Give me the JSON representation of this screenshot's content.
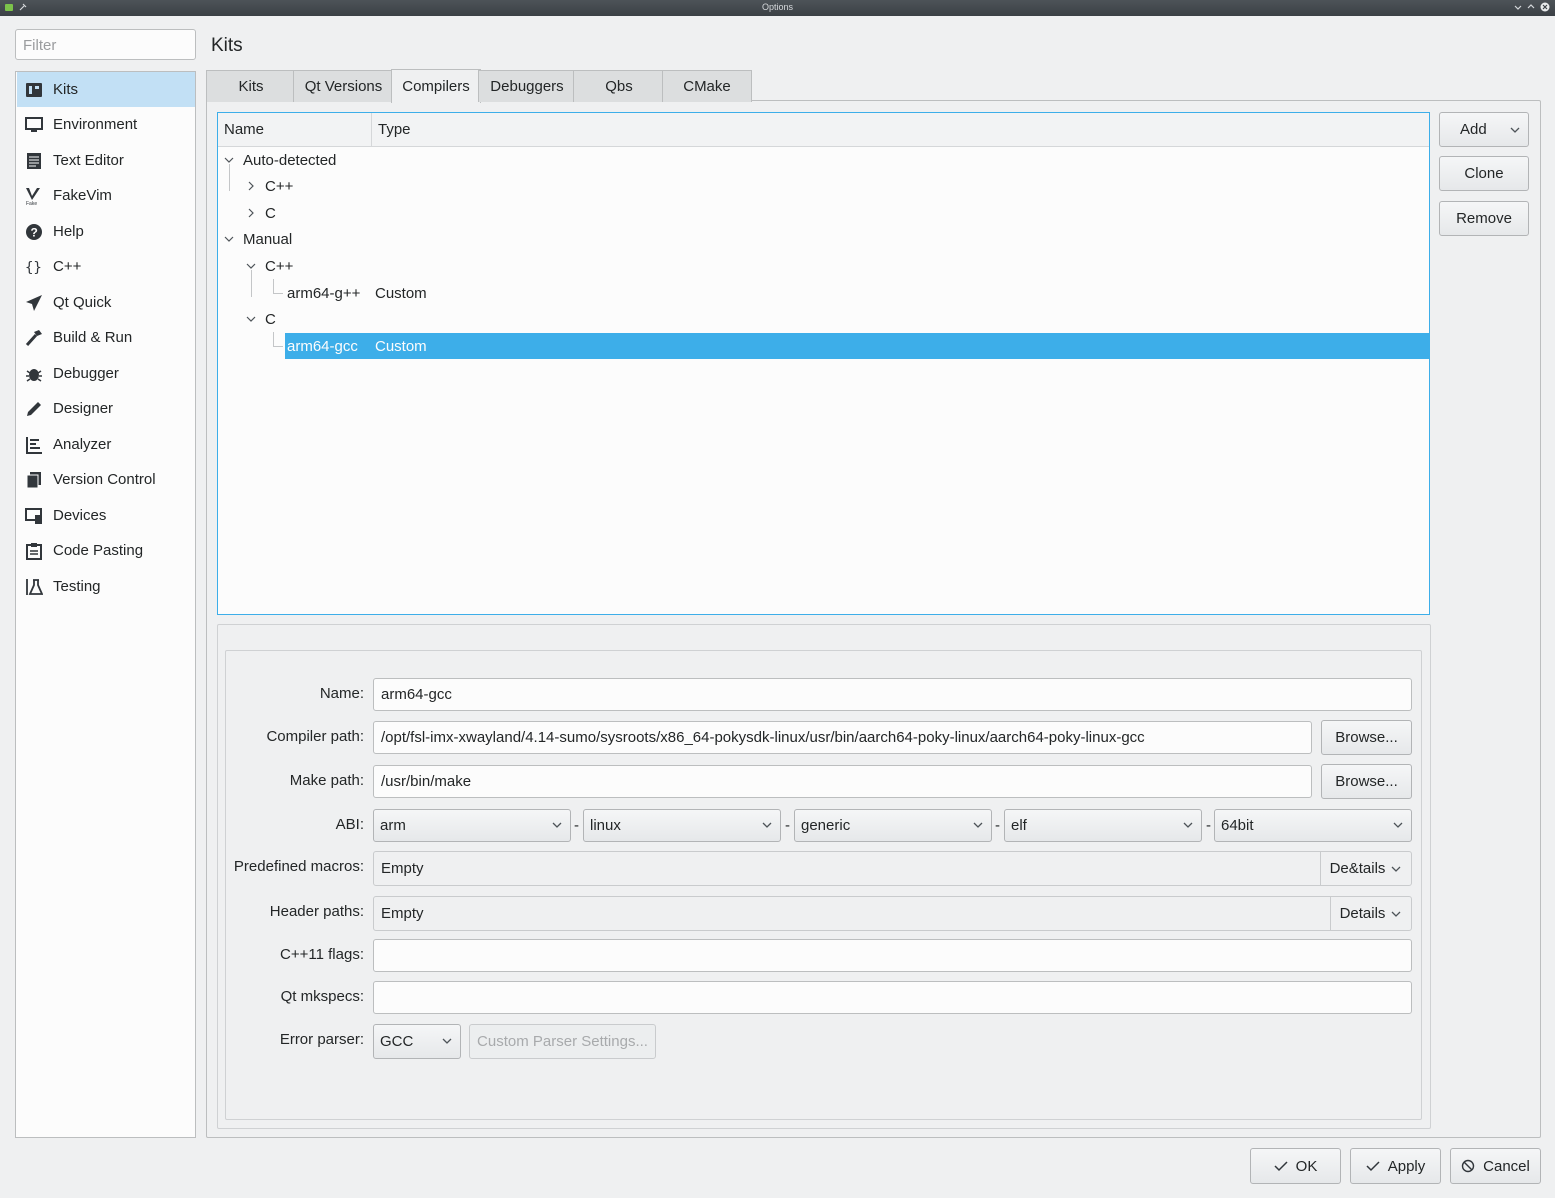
{
  "window": {
    "title": "Options"
  },
  "filter": {
    "placeholder": "Filter"
  },
  "sidebar": {
    "items": [
      {
        "label": "Kits",
        "icon": "kits-icon"
      },
      {
        "label": "Environment",
        "icon": "monitor-icon"
      },
      {
        "label": "Text Editor",
        "icon": "text-editor-icon"
      },
      {
        "label": "FakeVim",
        "icon": "fakevim-icon"
      },
      {
        "label": "Help",
        "icon": "help-icon"
      },
      {
        "label": "C++",
        "icon": "braces-icon"
      },
      {
        "label": "Qt Quick",
        "icon": "paper-plane-icon"
      },
      {
        "label": "Build & Run",
        "icon": "hammer-icon"
      },
      {
        "label": "Debugger",
        "icon": "bug-icon"
      },
      {
        "label": "Designer",
        "icon": "pencil-icon"
      },
      {
        "label": "Analyzer",
        "icon": "analyzer-icon"
      },
      {
        "label": "Version Control",
        "icon": "version-control-icon"
      },
      {
        "label": "Devices",
        "icon": "devices-icon"
      },
      {
        "label": "Code Pasting",
        "icon": "clipboard-icon"
      },
      {
        "label": "Testing",
        "icon": "flask-icon"
      }
    ]
  },
  "page": {
    "title": "Kits"
  },
  "tabs": [
    "Kits",
    "Qt Versions",
    "Compilers",
    "Debuggers",
    "Qbs",
    "CMake"
  ],
  "tree": {
    "columns": [
      "Name",
      "Type"
    ],
    "auto_detected": "Auto-detected",
    "auto_cpp": "C++",
    "auto_c": "C",
    "manual": "Manual",
    "manual_cpp": "C++",
    "manual_cpp_item": {
      "name": "arm64-g++",
      "type": "Custom"
    },
    "manual_c": "C",
    "manual_c_item": {
      "name": "arm64-gcc",
      "type": "Custom"
    }
  },
  "side_buttons": {
    "add": "Add",
    "clone": "Clone",
    "remove": "Remove"
  },
  "form": {
    "name_label": "Name:",
    "name_value": "arm64-gcc",
    "compiler_path_label": "Compiler path:",
    "compiler_path_value": "/opt/fsl-imx-xwayland/4.14-sumo/sysroots/x86_64-pokysdk-linux/usr/bin/aarch64-poky-linux/aarch64-poky-linux-gcc",
    "browse": "Browse...",
    "make_path_label": "Make path:",
    "make_path_value": "/usr/bin/make",
    "abi_label": "ABI:",
    "abi": [
      "arm",
      "linux",
      "generic",
      "elf",
      "64bit"
    ],
    "abi_sep": "-",
    "macros_label": "Predefined macros:",
    "macros_value": "Empty",
    "macros_details": "De&tails",
    "headers_label": "Header paths:",
    "headers_value": "Empty",
    "headers_details": "Details",
    "cpp11_label": "C++11 flags:",
    "cpp11_value": "",
    "mkspecs_label": "Qt mkspecs:",
    "mkspecs_value": "",
    "error_parser_label": "Error parser:",
    "error_parser_value": "GCC",
    "custom_parser": "Custom Parser Settings..."
  },
  "dialog_buttons": {
    "ok": "OK",
    "apply": "Apply",
    "cancel": "Cancel"
  }
}
